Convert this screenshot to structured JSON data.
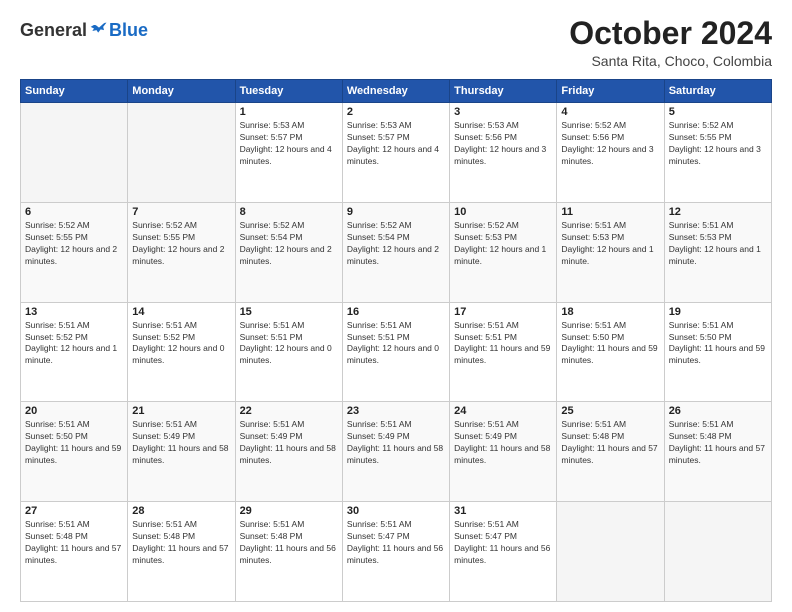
{
  "header": {
    "logo_general": "General",
    "logo_blue": "Blue",
    "month_title": "October 2024",
    "location": "Santa Rita, Choco, Colombia"
  },
  "weekdays": [
    "Sunday",
    "Monday",
    "Tuesday",
    "Wednesday",
    "Thursday",
    "Friday",
    "Saturday"
  ],
  "rows": [
    {
      "cells": [
        {
          "empty": true
        },
        {
          "empty": true
        },
        {
          "day": 1,
          "info": "Sunrise: 5:53 AM\nSunset: 5:57 PM\nDaylight: 12 hours and 4 minutes."
        },
        {
          "day": 2,
          "info": "Sunrise: 5:53 AM\nSunset: 5:57 PM\nDaylight: 12 hours and 4 minutes."
        },
        {
          "day": 3,
          "info": "Sunrise: 5:53 AM\nSunset: 5:56 PM\nDaylight: 12 hours and 3 minutes."
        },
        {
          "day": 4,
          "info": "Sunrise: 5:52 AM\nSunset: 5:56 PM\nDaylight: 12 hours and 3 minutes."
        },
        {
          "day": 5,
          "info": "Sunrise: 5:52 AM\nSunset: 5:55 PM\nDaylight: 12 hours and 3 minutes."
        }
      ]
    },
    {
      "cells": [
        {
          "day": 6,
          "info": "Sunrise: 5:52 AM\nSunset: 5:55 PM\nDaylight: 12 hours and 2 minutes."
        },
        {
          "day": 7,
          "info": "Sunrise: 5:52 AM\nSunset: 5:55 PM\nDaylight: 12 hours and 2 minutes."
        },
        {
          "day": 8,
          "info": "Sunrise: 5:52 AM\nSunset: 5:54 PM\nDaylight: 12 hours and 2 minutes."
        },
        {
          "day": 9,
          "info": "Sunrise: 5:52 AM\nSunset: 5:54 PM\nDaylight: 12 hours and 2 minutes."
        },
        {
          "day": 10,
          "info": "Sunrise: 5:52 AM\nSunset: 5:53 PM\nDaylight: 12 hours and 1 minute."
        },
        {
          "day": 11,
          "info": "Sunrise: 5:51 AM\nSunset: 5:53 PM\nDaylight: 12 hours and 1 minute."
        },
        {
          "day": 12,
          "info": "Sunrise: 5:51 AM\nSunset: 5:53 PM\nDaylight: 12 hours and 1 minute."
        }
      ]
    },
    {
      "cells": [
        {
          "day": 13,
          "info": "Sunrise: 5:51 AM\nSunset: 5:52 PM\nDaylight: 12 hours and 1 minute."
        },
        {
          "day": 14,
          "info": "Sunrise: 5:51 AM\nSunset: 5:52 PM\nDaylight: 12 hours and 0 minutes."
        },
        {
          "day": 15,
          "info": "Sunrise: 5:51 AM\nSunset: 5:51 PM\nDaylight: 12 hours and 0 minutes."
        },
        {
          "day": 16,
          "info": "Sunrise: 5:51 AM\nSunset: 5:51 PM\nDaylight: 12 hours and 0 minutes."
        },
        {
          "day": 17,
          "info": "Sunrise: 5:51 AM\nSunset: 5:51 PM\nDaylight: 11 hours and 59 minutes."
        },
        {
          "day": 18,
          "info": "Sunrise: 5:51 AM\nSunset: 5:50 PM\nDaylight: 11 hours and 59 minutes."
        },
        {
          "day": 19,
          "info": "Sunrise: 5:51 AM\nSunset: 5:50 PM\nDaylight: 11 hours and 59 minutes."
        }
      ]
    },
    {
      "cells": [
        {
          "day": 20,
          "info": "Sunrise: 5:51 AM\nSunset: 5:50 PM\nDaylight: 11 hours and 59 minutes."
        },
        {
          "day": 21,
          "info": "Sunrise: 5:51 AM\nSunset: 5:49 PM\nDaylight: 11 hours and 58 minutes."
        },
        {
          "day": 22,
          "info": "Sunrise: 5:51 AM\nSunset: 5:49 PM\nDaylight: 11 hours and 58 minutes."
        },
        {
          "day": 23,
          "info": "Sunrise: 5:51 AM\nSunset: 5:49 PM\nDaylight: 11 hours and 58 minutes."
        },
        {
          "day": 24,
          "info": "Sunrise: 5:51 AM\nSunset: 5:49 PM\nDaylight: 11 hours and 58 minutes."
        },
        {
          "day": 25,
          "info": "Sunrise: 5:51 AM\nSunset: 5:48 PM\nDaylight: 11 hours and 57 minutes."
        },
        {
          "day": 26,
          "info": "Sunrise: 5:51 AM\nSunset: 5:48 PM\nDaylight: 11 hours and 57 minutes."
        }
      ]
    },
    {
      "cells": [
        {
          "day": 27,
          "info": "Sunrise: 5:51 AM\nSunset: 5:48 PM\nDaylight: 11 hours and 57 minutes."
        },
        {
          "day": 28,
          "info": "Sunrise: 5:51 AM\nSunset: 5:48 PM\nDaylight: 11 hours and 57 minutes."
        },
        {
          "day": 29,
          "info": "Sunrise: 5:51 AM\nSunset: 5:48 PM\nDaylight: 11 hours and 56 minutes."
        },
        {
          "day": 30,
          "info": "Sunrise: 5:51 AM\nSunset: 5:47 PM\nDaylight: 11 hours and 56 minutes."
        },
        {
          "day": 31,
          "info": "Sunrise: 5:51 AM\nSunset: 5:47 PM\nDaylight: 11 hours and 56 minutes."
        },
        {
          "empty": true
        },
        {
          "empty": true
        }
      ]
    }
  ]
}
